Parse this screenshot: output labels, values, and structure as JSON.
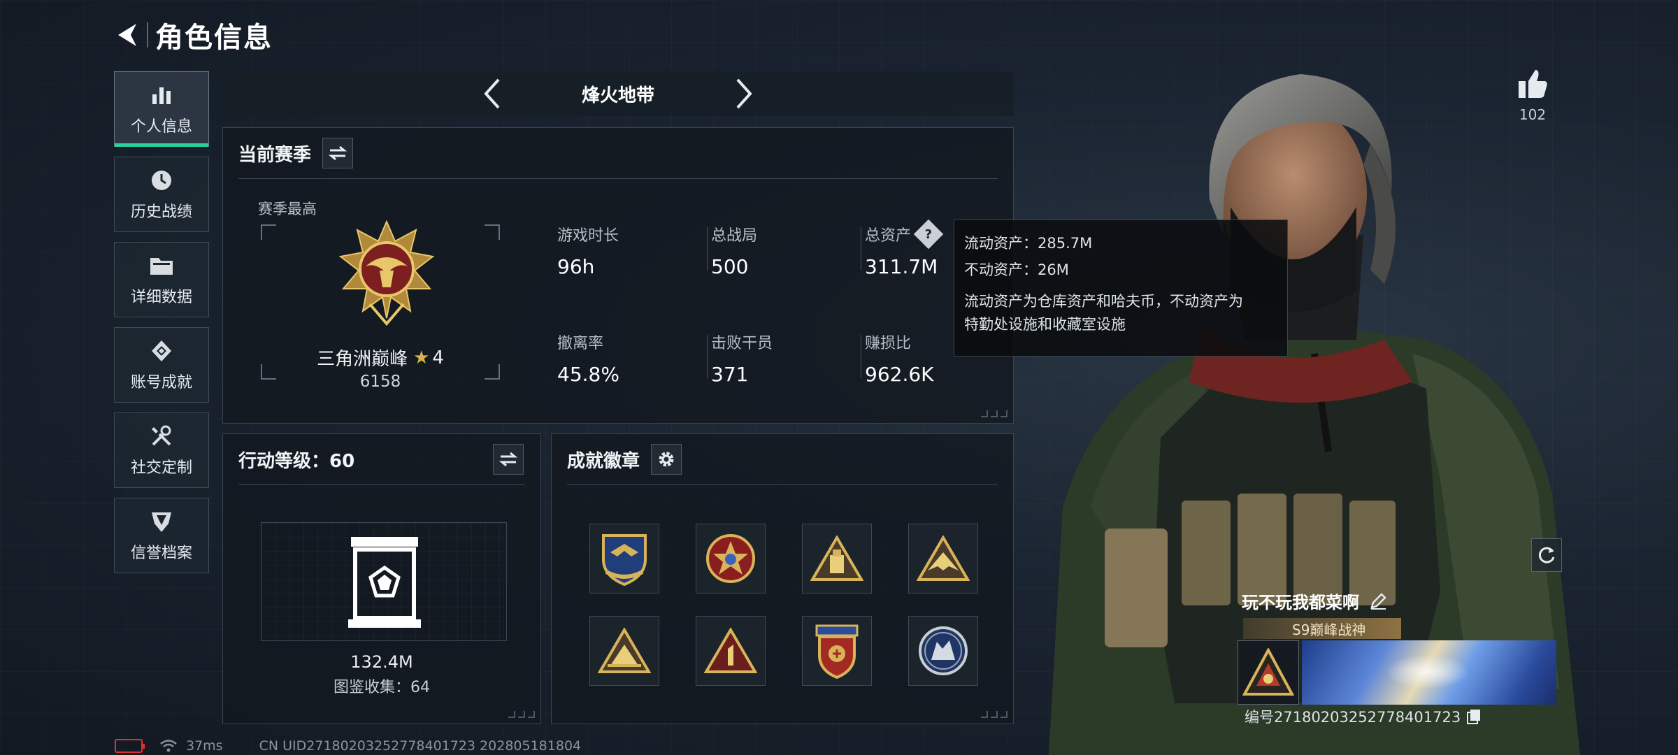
{
  "header": {
    "title": "角色信息"
  },
  "sidebar": {
    "items": [
      {
        "label": "个人信息",
        "icon": "bar-chart-icon",
        "active": true
      },
      {
        "label": "历史战绩",
        "icon": "clock-icon",
        "active": false
      },
      {
        "label": "详细数据",
        "icon": "folder-icon",
        "active": false
      },
      {
        "label": "账号成就",
        "icon": "achievement-icon",
        "active": false
      },
      {
        "label": "社交定制",
        "icon": "tools-icon",
        "active": false
      },
      {
        "label": "信誉档案",
        "icon": "shield-icon",
        "active": false
      }
    ]
  },
  "mode": {
    "title": "烽火地带"
  },
  "season": {
    "title": "当前赛季",
    "best_label": "赛季最高",
    "rank_name": "三角洲巅峰",
    "rank_star": "★",
    "rank_stars": "4",
    "rank_score": "6158",
    "stats": [
      {
        "label": "游戏时长",
        "value": "96h"
      },
      {
        "label": "总战局",
        "value": "500"
      },
      {
        "label": "总资产",
        "value": "311.7M"
      },
      {
        "label": "撤离率",
        "value": "45.8%"
      },
      {
        "label": "击败干员",
        "value": "371"
      },
      {
        "label": "赚损比",
        "value": "962.6K"
      }
    ],
    "help_glyph": "?"
  },
  "tooltip": {
    "liquid": "流动资产：285.7M",
    "fixed": "不动资产：26M",
    "desc_line1": "流动资产为仓库资产和哈夫币，不动资产为",
    "desc_line2": "特勤处设施和收藏室设施"
  },
  "level": {
    "title": "行动等级：60",
    "collection_value": "132.4M",
    "collection_label": "图鉴收集：64"
  },
  "badges": {
    "title": "成就徽章",
    "items": [
      "badge-1",
      "badge-2",
      "badge-3",
      "badge-4",
      "badge-5",
      "badge-6",
      "badge-7",
      "badge-8"
    ]
  },
  "profile": {
    "likes": "102",
    "name": "玩不玩我都菜啊",
    "title_badge": "S9巅峰战神",
    "player_id": "编号271802032527784017​23"
  },
  "status": {
    "latency": "37ms",
    "uid": "CN UID271802032527784017​23 202805181804"
  },
  "colors": {
    "accent": "#27d39a",
    "gold": "#d8b24a",
    "battery_low": "#e0312d"
  }
}
